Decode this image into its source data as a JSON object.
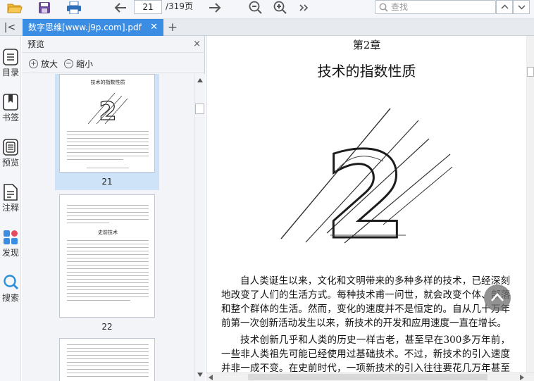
{
  "toolbar": {
    "page_current": "21",
    "page_total": "/319页",
    "search_placeholder": "查找"
  },
  "tab": {
    "title": "数字思维[www.j9p.com].pdf",
    "close": "✕",
    "add": "+"
  },
  "rail": {
    "collapse": "|<",
    "items": [
      {
        "label": "目录",
        "icon": "toc-icon"
      },
      {
        "label": "书签",
        "icon": "bookmark-icon"
      },
      {
        "label": "预览",
        "icon": "preview-icon"
      },
      {
        "label": "注释",
        "icon": "annotation-icon"
      },
      {
        "label": "发现",
        "icon": "discover-icon"
      },
      {
        "label": "搜索",
        "icon": "search-icon"
      }
    ]
  },
  "panel": {
    "title": "预览",
    "close": "×",
    "zoom_in": "放大",
    "zoom_out": "缩小",
    "thumbnails": [
      {
        "label": "21",
        "heading": "技术的指数性质",
        "selected": true
      },
      {
        "label": "22",
        "heading": "史前技术",
        "selected": false
      }
    ]
  },
  "document": {
    "chapter": "第2章",
    "title": "技术的指数性质",
    "big_numeral": "2",
    "paragraphs": [
      "自人类诞生以来，文化和文明带来的多种多样的技术，已经深刻地改变了人们的生活方式。每种技术甫一问世，就会改变个体、部落和整个群体的生活。然而，变化的速度并不是恒定的。自从几十万年前第一次创新活动发生以来，新技术的开发和应用速度一直在增长。",
      "技术创新几乎和人类的历史一样古老，甚至早在300多万年前，一些非人类祖先可能已经使用过基础技术。不过，新技术的引入速度并非一成不变。在史前时代，一项新技术的引入往往要花几万年甚至是"
    ]
  },
  "colors": {
    "accent": "#3b8de4",
    "selection": "#cfe3f8",
    "toolbar_bg": "#f4f6f9"
  }
}
